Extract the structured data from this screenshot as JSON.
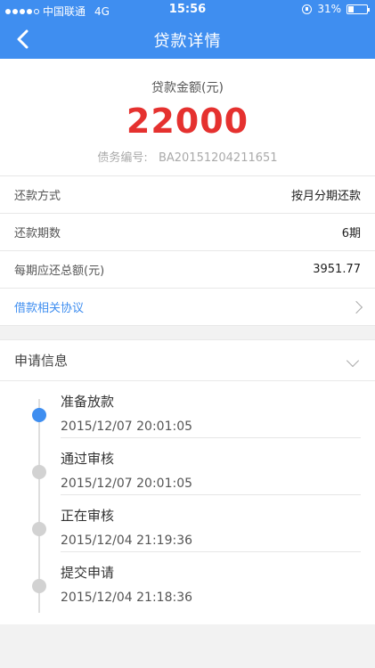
{
  "status_bar": {
    "carrier": "中国联通",
    "network": "4G",
    "time": "15:56",
    "battery": "31%",
    "battery_level": 0.31
  },
  "nav": {
    "title": "贷款详情"
  },
  "loan": {
    "amount_label": "贷款金额(元)",
    "amount": "22000",
    "debt_no_label": "债务编号:",
    "debt_no": "BA20151204211651"
  },
  "details": [
    {
      "label": "还款方式",
      "value": "按月分期还款"
    },
    {
      "label": "还款期数",
      "value": "6期"
    },
    {
      "label": "每期应还总额(元)",
      "value": "3951.77"
    }
  ],
  "agreement_link": "借款相关协议",
  "application": {
    "title": "申请信息",
    "steps": [
      {
        "title": "准备放款",
        "time": "2015/12/07 20:01:05",
        "active": true
      },
      {
        "title": "通过审核",
        "time": "2015/12/07 20:01:05",
        "active": false
      },
      {
        "title": "正在审核",
        "time": "2015/12/04 21:19:36",
        "active": false
      },
      {
        "title": "提交申请",
        "time": "2015/12/04 21:18:36",
        "active": false
      }
    ]
  },
  "colors": {
    "primary": "#3f8ef0",
    "amount_red": "#e5312f",
    "inactive_dot": "#d2d2d2"
  }
}
